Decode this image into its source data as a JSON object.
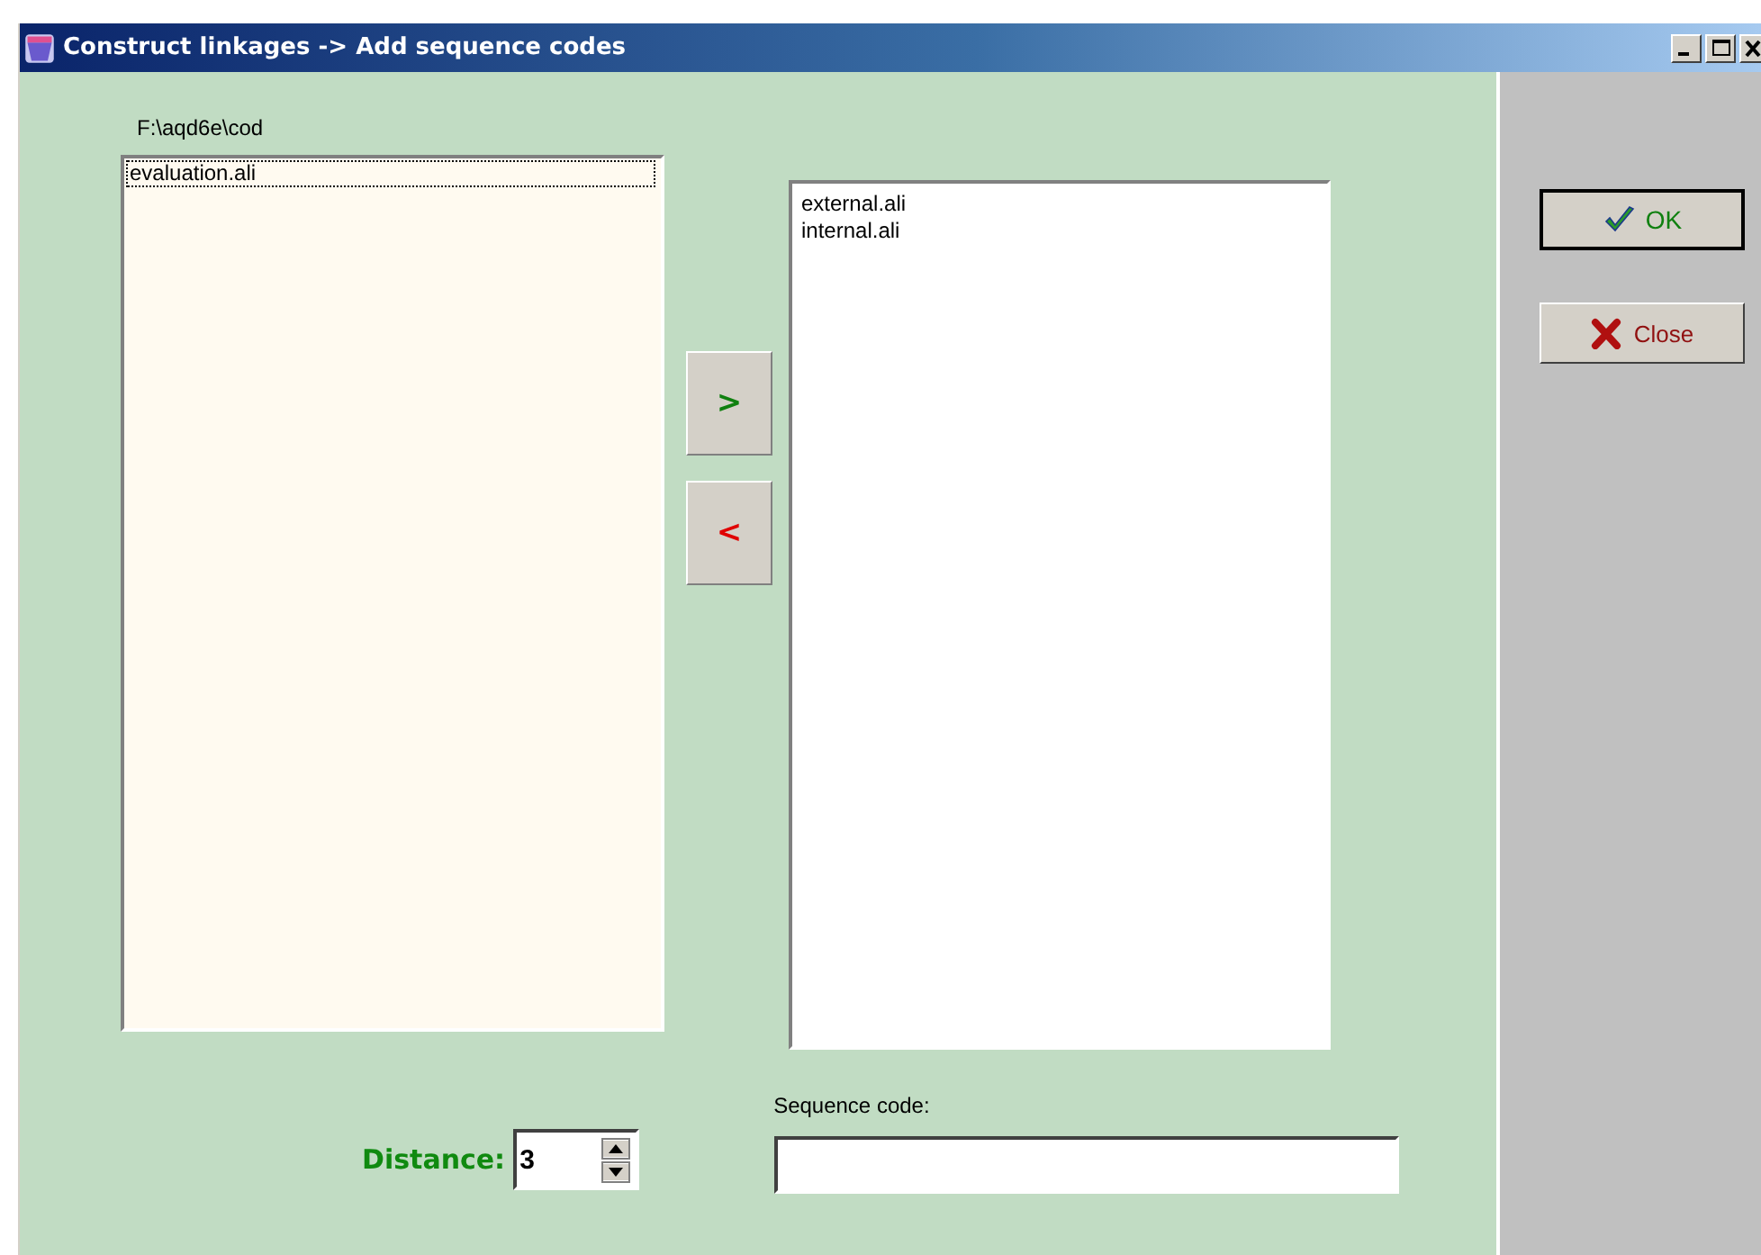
{
  "window": {
    "title": "Construct linkages -> Add sequence codes"
  },
  "folder_path": "F:\\aqd6e\\cod",
  "source_list": {
    "items": [
      {
        "label": "evaluation.ali",
        "selected": true
      }
    ]
  },
  "move_buttons": [
    {
      "label": ">",
      "kind": "add"
    },
    {
      "label": "<",
      "kind": "remove"
    }
  ],
  "target_list": {
    "items": [
      {
        "label": "external.ali",
        "selected": false
      },
      {
        "label": "internal.ali",
        "selected": false
      }
    ]
  },
  "distance": {
    "label": "Distance:",
    "value": "3"
  },
  "sequence_code": {
    "label": "Sequence code:"
  },
  "buttons": [
    {
      "label": "OK",
      "kind": "ok"
    },
    {
      "label": "Close",
      "kind": "close"
    }
  ]
}
